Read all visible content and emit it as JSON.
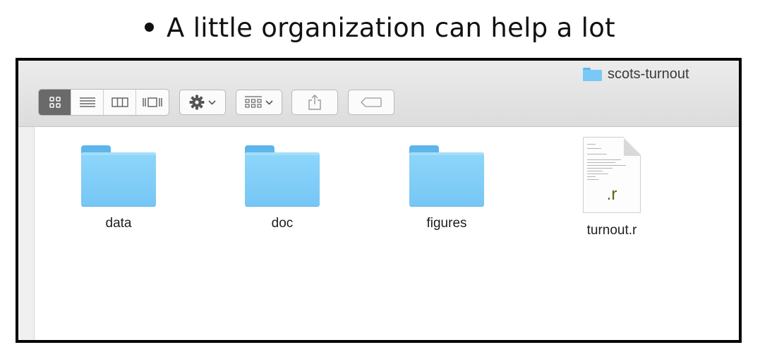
{
  "slide": {
    "bullet_text": "A little organization can help a lot"
  },
  "window": {
    "title": "scots-turnout"
  },
  "toolbar": {
    "view_modes": [
      "icon-view",
      "list-view",
      "column-view",
      "cover-flow-view"
    ],
    "active_view": "icon-view"
  },
  "files": [
    {
      "name": "data",
      "kind": "folder"
    },
    {
      "name": "doc",
      "kind": "folder"
    },
    {
      "name": "figures",
      "kind": "folder"
    },
    {
      "name": "turnout.r",
      "kind": "file",
      "extension": ".r"
    }
  ],
  "colors": {
    "folder": "#79c9f6",
    "active_segment": "#6a6a6a",
    "extension": "#4d6a13"
  }
}
